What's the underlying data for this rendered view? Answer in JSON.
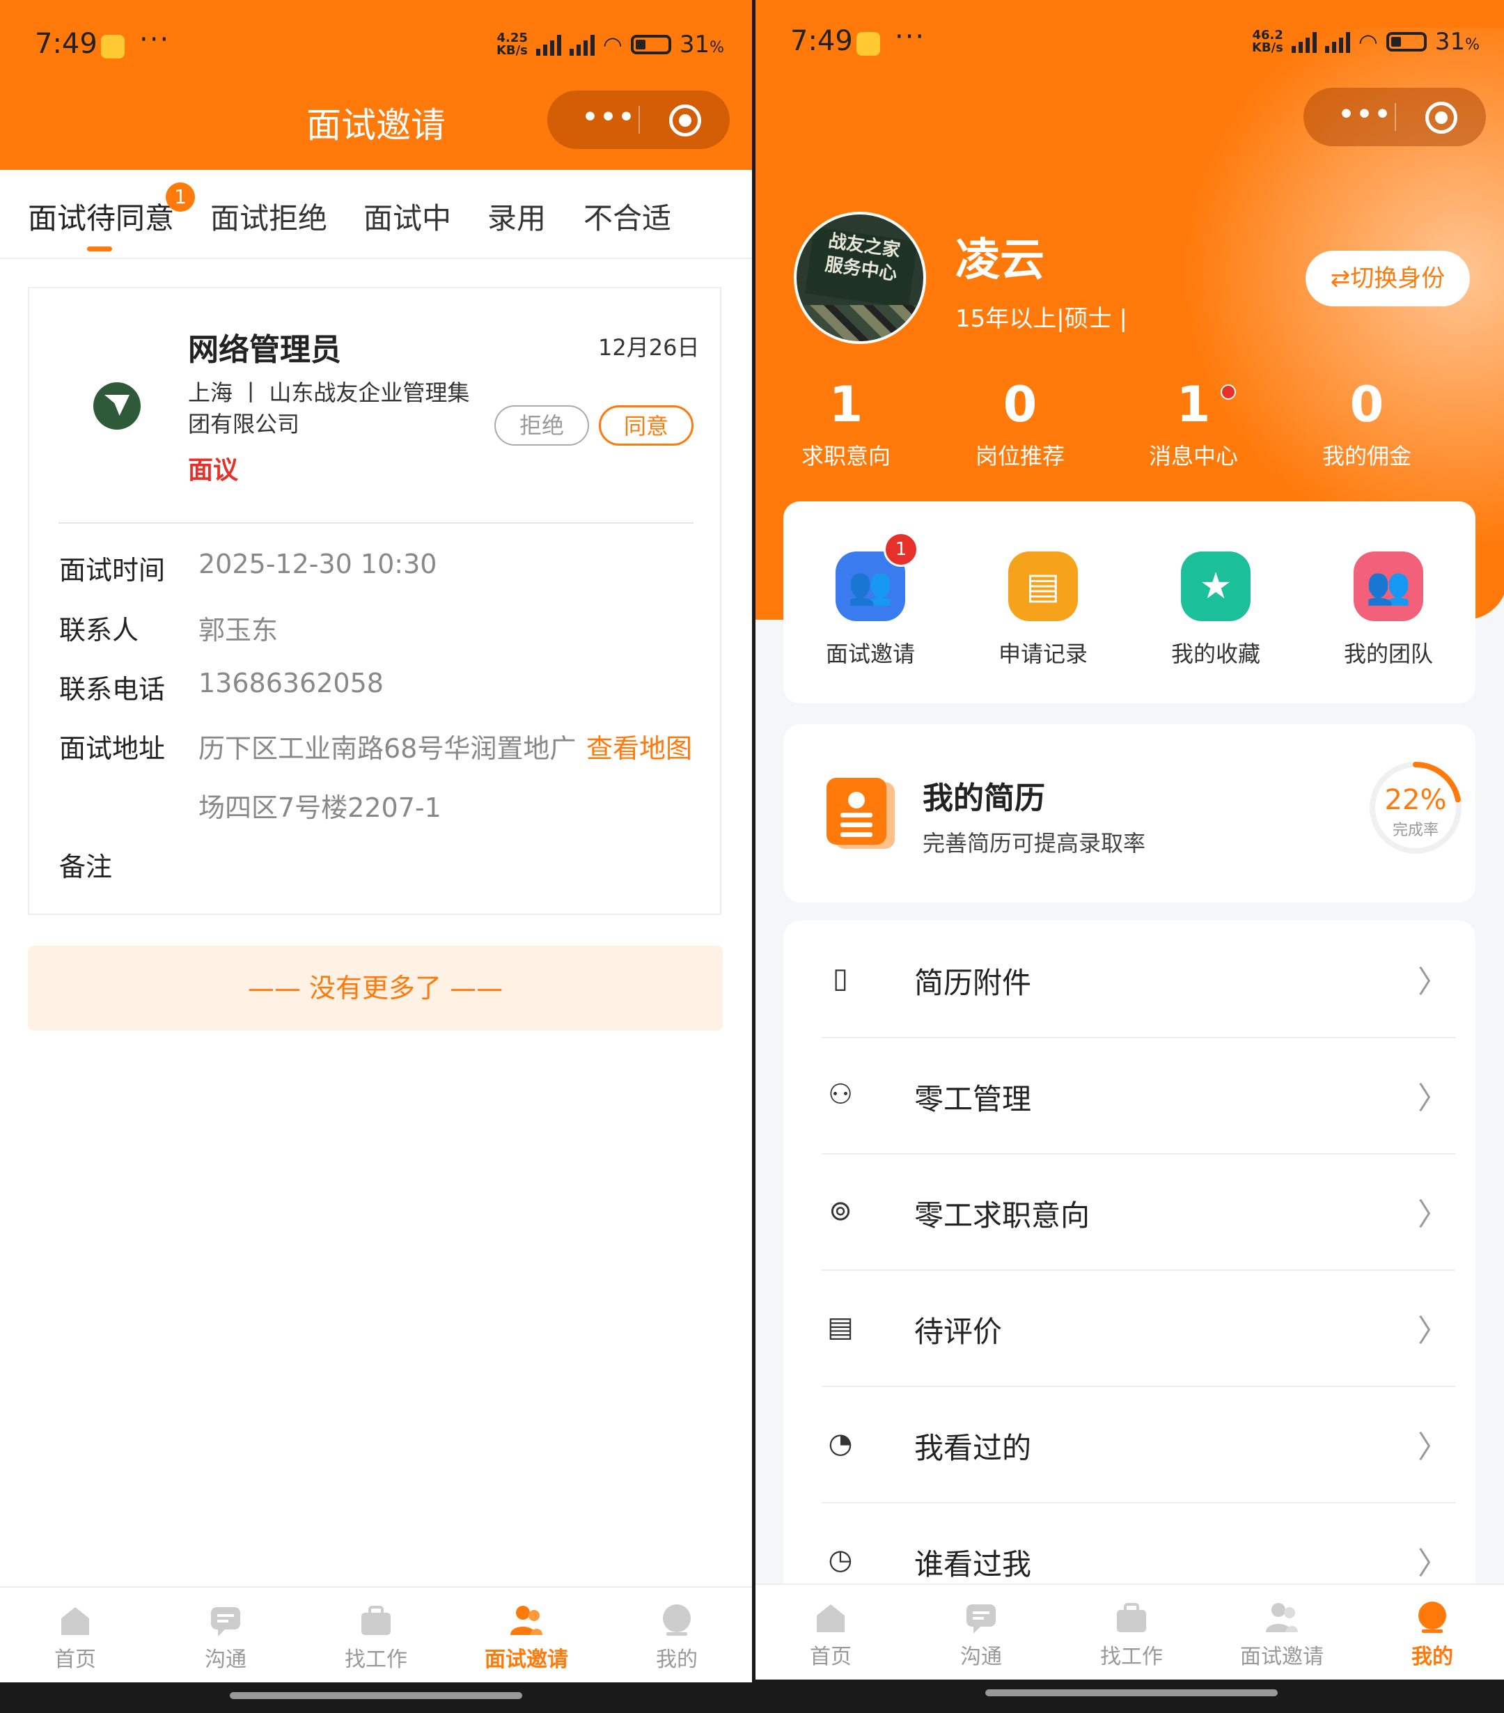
{
  "left": {
    "status": {
      "time": "7:49",
      "speed_top": "4.25",
      "speed_bottom": "KB/s",
      "battery": "31",
      "battery_unit": "%"
    },
    "header": {
      "title": "面试邀请"
    },
    "tabs": [
      {
        "label": "面试待同意",
        "badge": "1"
      },
      {
        "label": "面试拒绝"
      },
      {
        "label": "面试中"
      },
      {
        "label": "录用"
      },
      {
        "label": "不合适"
      }
    ],
    "card": {
      "job_title": "网络管理员",
      "date": "12月26日",
      "location_company_line1": "上海 丨 山东战友企业管理集",
      "location_company_line2": "团有限公司",
      "salary": "面议",
      "reject_label": "拒绝",
      "agree_label": "同意",
      "rows": {
        "time_label": "面试时间",
        "time_value": "2025-12-30 10:30",
        "contact_label": "联系人",
        "contact_value": "郭玉东",
        "phone_label": "联系电话",
        "phone_value": "13686362058",
        "address_label": "面试地址",
        "address_line1": "历下区工业南路68号华润置地广",
        "address_line2": "场四区7号楼2207-1",
        "map_link": "查看地图",
        "note_label": "备注"
      }
    },
    "no_more": "—— 没有更多了 ——",
    "tabbar": [
      {
        "label": "首页",
        "icon": "home-icon"
      },
      {
        "label": "沟通",
        "icon": "chat-icon"
      },
      {
        "label": "找工作",
        "icon": "briefcase-icon"
      },
      {
        "label": "面试邀请",
        "icon": "people-icon",
        "active": true
      },
      {
        "label": "我的",
        "icon": "profile-icon"
      }
    ]
  },
  "right": {
    "status": {
      "time": "7:49",
      "speed_top": "46.2",
      "speed_bottom": "KB/s",
      "battery": "31",
      "battery_unit": "%"
    },
    "profile": {
      "name": "凌云",
      "subtitle": "15年以上|硕士 |",
      "switch_label": "⇄切换身份",
      "avatar_text_1": "战友之家",
      "avatar_text_2": "服务中心"
    },
    "stats": [
      {
        "value": "1",
        "label": "求职意向"
      },
      {
        "value": "0",
        "label": "岗位推荐"
      },
      {
        "value": "1",
        "label": "消息中心"
      },
      {
        "value": "0",
        "label": "我的佣金"
      }
    ],
    "quick": [
      {
        "label": "面试邀请",
        "icon": "interview-invite-icon",
        "color": "#3a7bf0",
        "badge": "1"
      },
      {
        "label": "申请记录",
        "icon": "application-record-icon",
        "color": "#f7a21b"
      },
      {
        "label": "我的收藏",
        "icon": "star-icon",
        "color": "#1bbf9a"
      },
      {
        "label": "我的团队",
        "icon": "team-icon",
        "color": "#f2607a"
      }
    ],
    "resume": {
      "title": "我的简历",
      "subtitle": "完善简历可提高录取率",
      "percent_text": "22%",
      "percent_value": 22,
      "percent_label": "完成率"
    },
    "menu": [
      {
        "label": "简历附件",
        "icon": "attachment-doc-icon"
      },
      {
        "label": "零工管理",
        "icon": "users-icon"
      },
      {
        "label": "零工求职意向",
        "icon": "user-circle-icon"
      },
      {
        "label": "待评价",
        "icon": "clipboard-icon"
      },
      {
        "label": "我看过的",
        "icon": "history-icon"
      },
      {
        "label": "谁看过我",
        "icon": "calendar-clock-icon"
      }
    ],
    "tabbar": [
      {
        "label": "首页",
        "icon": "home-icon"
      },
      {
        "label": "沟通",
        "icon": "chat-icon"
      },
      {
        "label": "找工作",
        "icon": "briefcase-icon"
      },
      {
        "label": "面试邀请",
        "icon": "people-icon"
      },
      {
        "label": "我的",
        "icon": "profile-icon",
        "active": true
      }
    ]
  },
  "colors": {
    "brand": "#ff7a0b",
    "danger": "#e8302a",
    "tab_inactive": "#999999"
  }
}
